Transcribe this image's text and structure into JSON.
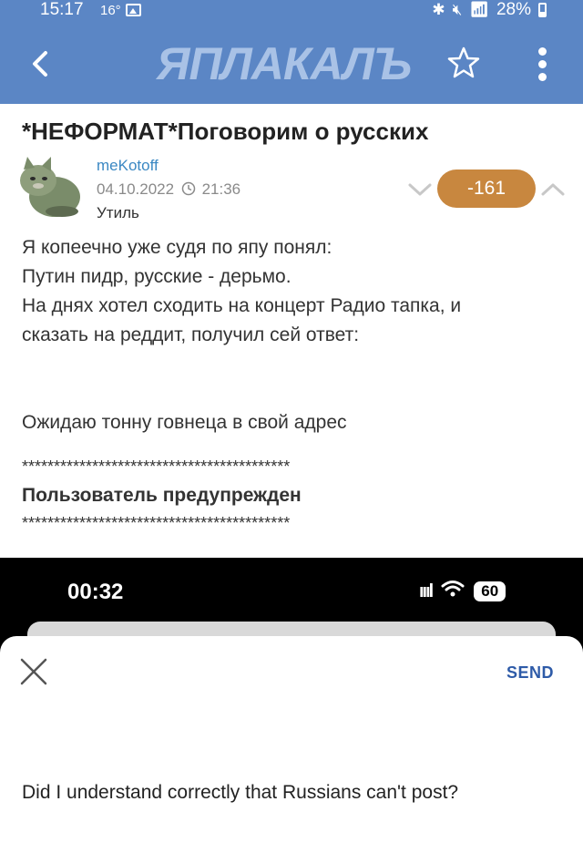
{
  "status_bar": {
    "time": "15:17",
    "temperature": "16°",
    "battery": "28%"
  },
  "app_bar": {
    "logo": "ЯПЛАКАЛЪ"
  },
  "post": {
    "title": "*НЕФОРМАТ*Поговорим о русских",
    "author": "meKotoff",
    "date": "04.10.2022",
    "clock_icon": "clock-icon",
    "time": "21:36",
    "rank": "Утиль",
    "rating": "-161",
    "rating_color": "#c8873f",
    "body_lines": [
      "Я копеечно уже судя по япу понял:",
      "Путин пидр, русские - дерьмо.",
      "На днях хотел сходить на концерт Радио тапка, и",
      "сказать на реддит, получил сей ответ:",
      "",
      "",
      "Ожидаю тонну говнеца в свой адрес"
    ],
    "separator": "******************************************",
    "warning": "Пользователь предупрежден"
  },
  "embedded_screenshot": {
    "time": "00:32",
    "battery": "60",
    "send_label": "SEND",
    "question": "Did I understand correctly that Russians can't post?"
  },
  "colors": {
    "header_bg": "#5b86c5",
    "author_link": "#3b88c3",
    "send_link": "#2e5ba8"
  }
}
